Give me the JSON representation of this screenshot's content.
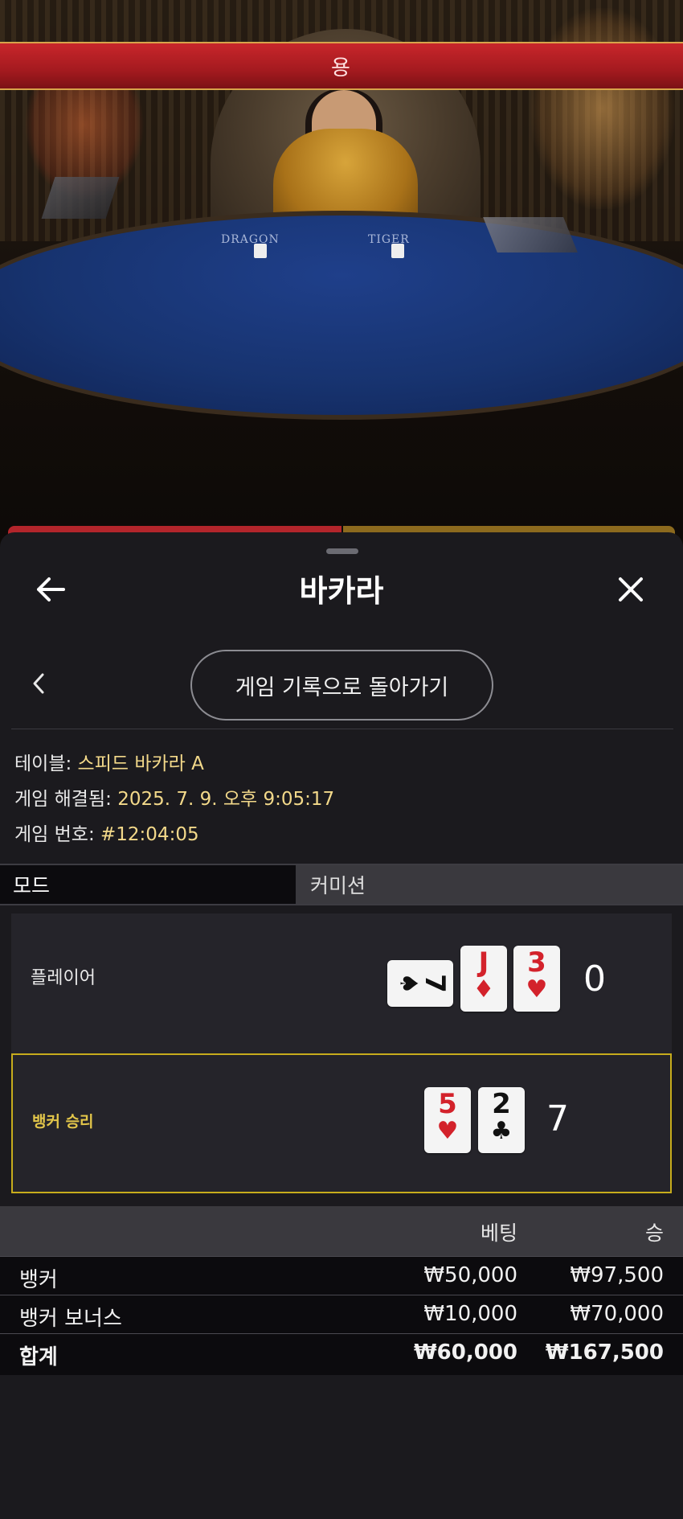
{
  "video": {
    "banner_text": "용",
    "table_label_left": "DRAGON",
    "table_label_right": "TIGER"
  },
  "header": {
    "title": "바카라",
    "back_icon": "arrow-left-icon",
    "close_icon": "close-icon"
  },
  "history_nav": {
    "prev_icon": "chevron-left-icon",
    "back_to_history_label": "게임 기록으로 돌아가기"
  },
  "game_info": {
    "table_label": "테이블:",
    "table_value": "스피드 바카라 A",
    "resolved_label": "게임 해결됨:",
    "resolved_value": "2025. 7. 9. 오후 9:05:17",
    "game_no_label": "게임 번호:",
    "game_no_value": "#12:04:05"
  },
  "tabs": {
    "mode": "모드",
    "commission": "커미션"
  },
  "result": {
    "player": {
      "label": "플레이어",
      "score": "0",
      "cards": [
        {
          "rank": "7",
          "suit": "♠",
          "color": "black",
          "sideways": true
        },
        {
          "rank": "J",
          "suit": "♦",
          "color": "red",
          "sideways": false
        },
        {
          "rank": "3",
          "suit": "♥",
          "color": "red",
          "sideways": false
        }
      ]
    },
    "banker": {
      "label": "뱅커 승리",
      "score": "7",
      "cards": [
        {
          "rank": "5",
          "suit": "♥",
          "color": "red",
          "sideways": false
        },
        {
          "rank": "2",
          "suit": "♣",
          "color": "black",
          "sideways": false
        }
      ]
    },
    "winner_highlight_color": "#c7ac1c"
  },
  "bets": {
    "col_bet": "베팅",
    "col_win": "승",
    "rows": [
      {
        "name": "뱅커",
        "bet": "₩50,000",
        "win": "₩97,500"
      },
      {
        "name": "뱅커 보너스",
        "bet": "₩10,000",
        "win": "₩70,000"
      }
    ],
    "total": {
      "name": "합계",
      "bet": "₩60,000",
      "win": "₩167,500"
    }
  }
}
